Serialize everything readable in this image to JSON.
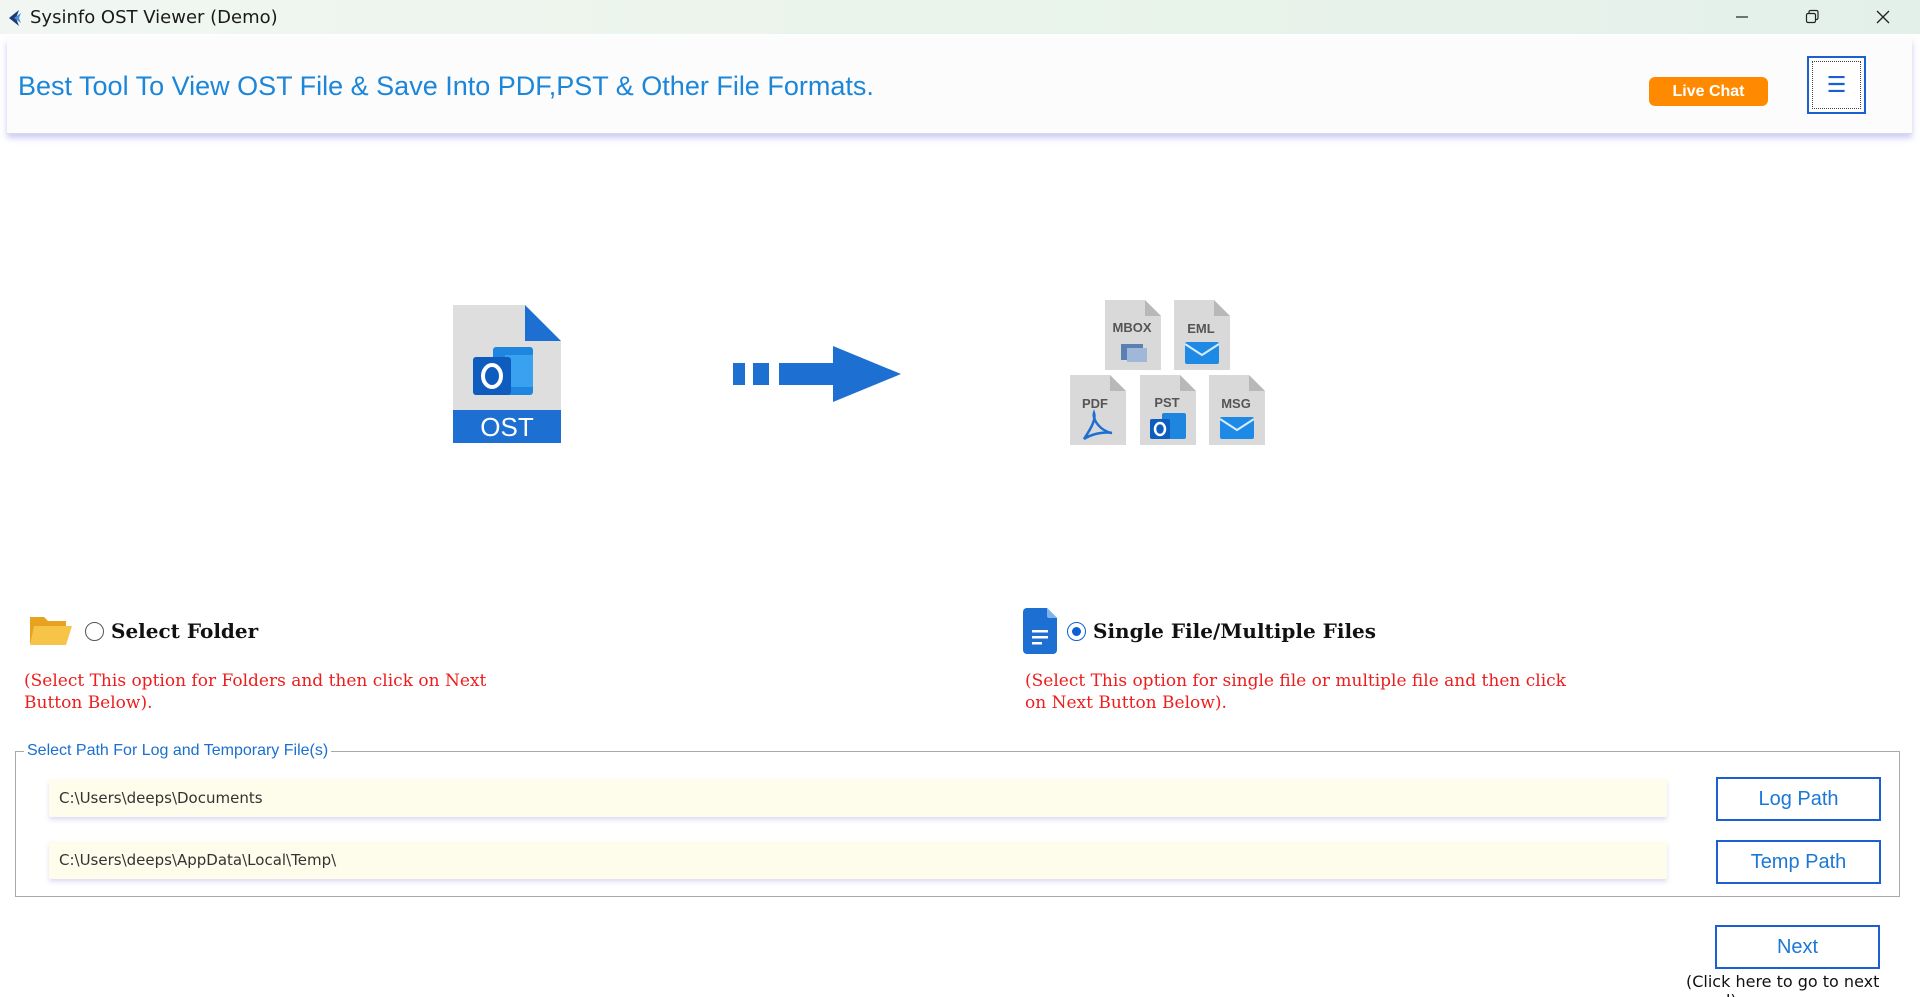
{
  "window": {
    "title": "Sysinfo OST Viewer (Demo)"
  },
  "header": {
    "title": "Best Tool To View OST File & Save Into PDF,PST & Other File Formats.",
    "live_chat_label": "Live Chat",
    "menu_glyph": "☰"
  },
  "illustration": {
    "source_label": "OST",
    "target_formats": [
      "MBOX",
      "EML",
      "PDF",
      "PST",
      "MSG"
    ]
  },
  "options": {
    "folder": {
      "label": "Select Folder",
      "hint": "(Select This option for Folders and then click on Next Button Below).",
      "selected": false
    },
    "files": {
      "label": "Single File/Multiple Files",
      "hint": "(Select This option for single file or multiple file and then click on Next Button Below).",
      "selected": true
    }
  },
  "paths": {
    "group_label": "Select Path For Log and Temporary File(s)",
    "log_path_value": "C:\\Users\\deeps\\Documents",
    "temp_path_value": "C:\\Users\\deeps\\AppData\\Local\\Temp\\",
    "log_path_button": "Log Path",
    "temp_path_button": "Temp Path"
  },
  "footer": {
    "next_label": "Next",
    "next_hint": "(Click here to go to next panel)"
  },
  "colors": {
    "accent_blue": "#1c86d9",
    "button_border": "#1b5fd0",
    "live_chat": "#ff8a00",
    "hint_red": "#ee1c1c"
  }
}
